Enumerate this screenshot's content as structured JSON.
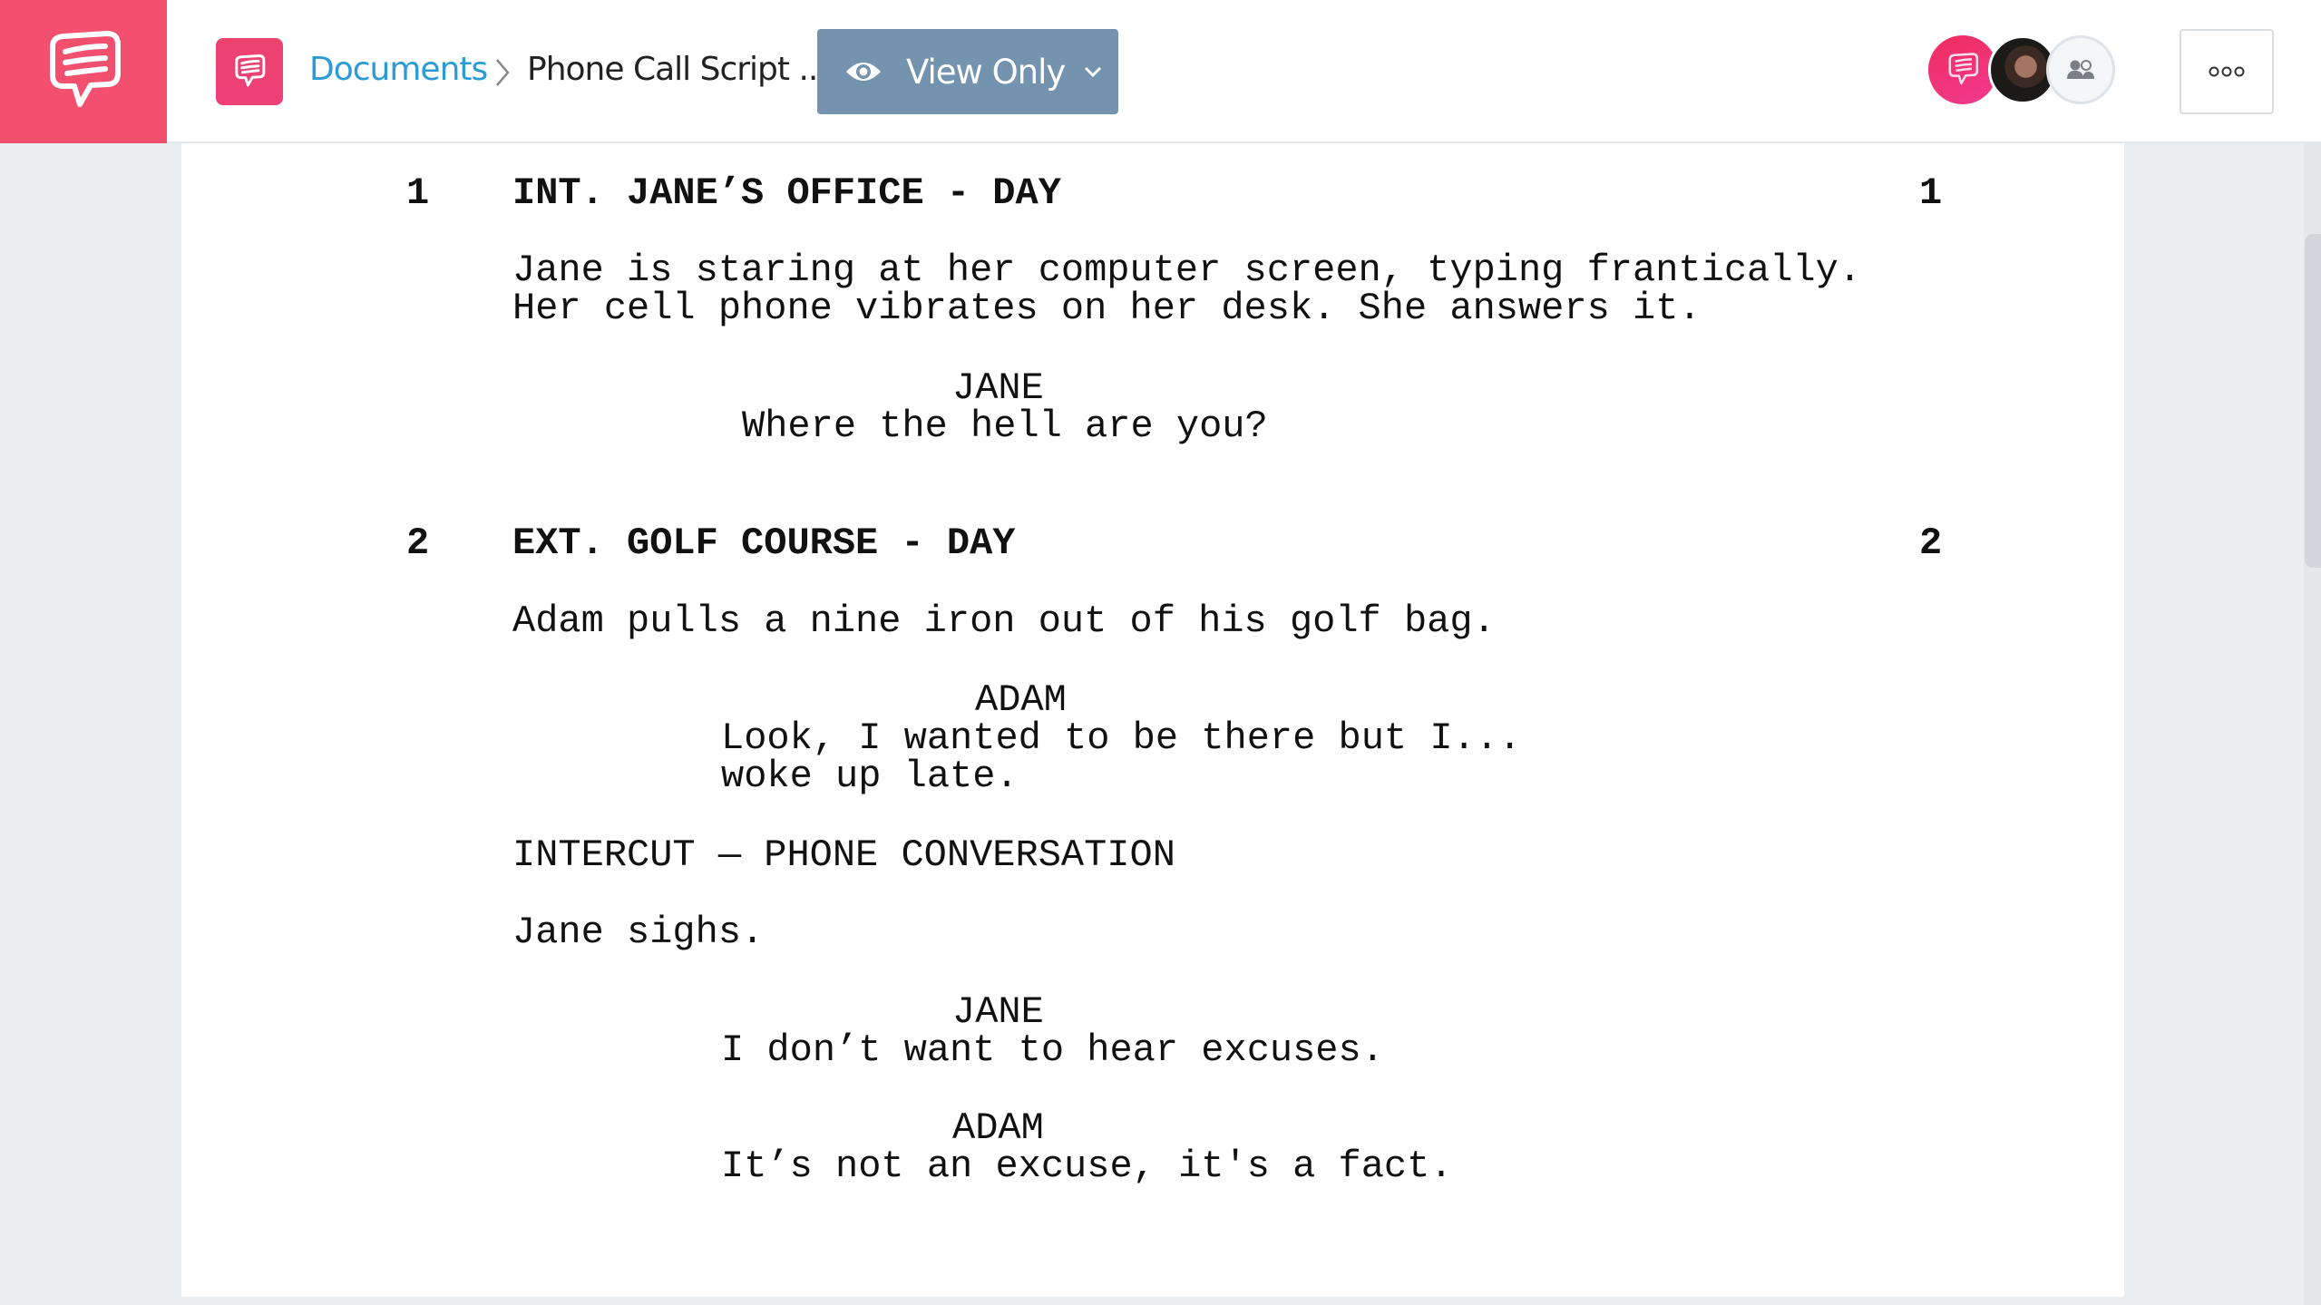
{
  "header": {
    "logo_icon": "speech-bubble-icon",
    "app_icon": "speech-bubble-icon",
    "breadcrumb": {
      "root": "Documents",
      "separator_icon": "chevron-right-icon",
      "current": "Phone Call Script .."
    },
    "view_mode_button": {
      "icon": "eye-icon",
      "label": "View Only",
      "dropdown_icon": "chevron-down-icon"
    },
    "collaborators": [
      {
        "type": "app-avatar",
        "icon": "speech-bubble-icon"
      },
      {
        "type": "user-photo"
      },
      {
        "type": "share",
        "icon": "users-icon"
      }
    ],
    "more_button": {
      "icon": "more-options-icon",
      "label": "ooo"
    }
  },
  "colors": {
    "brand": "#f2506e",
    "link": "#2a9bd5",
    "view_button": "#7393ae"
  },
  "script": {
    "scenes": [
      {
        "number": "1",
        "heading": "INT. JANE’S OFFICE - DAY",
        "action": [
          "Jane is staring at her computer screen, typing frantically.",
          "Her cell phone vibrates on her desk. She answers it."
        ],
        "dialogue": [
          {
            "character": "JANE",
            "lines": [
              "Where the hell are you?"
            ]
          }
        ]
      },
      {
        "number": "2",
        "heading": "EXT. GOLF COURSE - DAY",
        "action": [
          "Adam pulls a nine iron out of his golf bag."
        ],
        "dialogue_1": {
          "character": "ADAM",
          "lines": [
            "Look, I wanted to be there but I...",
            "woke up late."
          ]
        },
        "transition": "INTERCUT — PHONE CONVERSATION",
        "action_2": "Jane sighs.",
        "dialogue_2": {
          "character": "JANE",
          "lines": [
            "I don’t want to hear excuses."
          ]
        },
        "dialogue_3": {
          "character": "ADAM",
          "lines": [
            "It’s not an excuse, it's a fact."
          ]
        }
      }
    ]
  }
}
